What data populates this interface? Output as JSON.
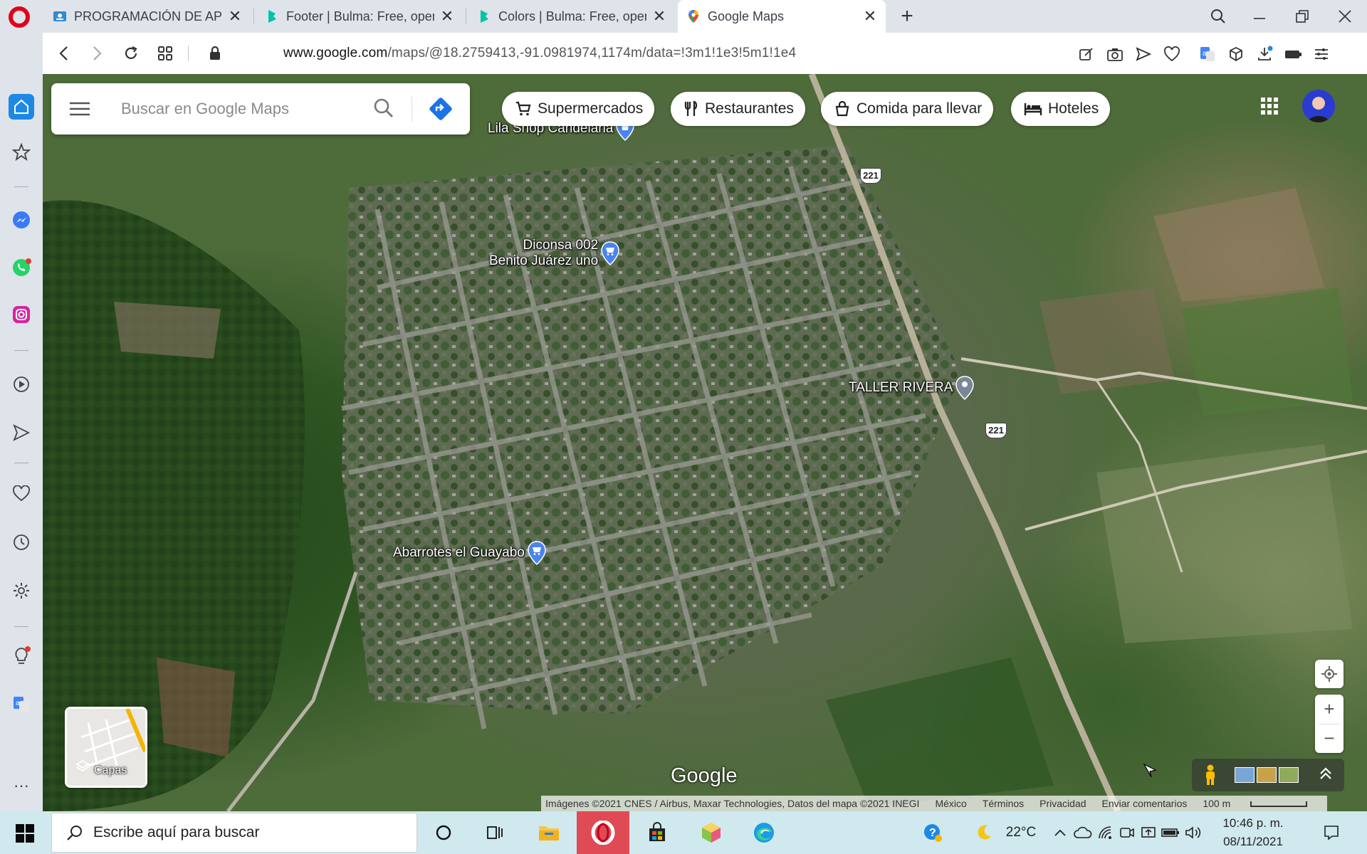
{
  "browser": {
    "tabs": [
      {
        "title": "PROGRAMACIÓN DE APLIC",
        "icon": "classroom-icon"
      },
      {
        "title": "Footer | Bulma: Free, open",
        "icon": "bulma-icon"
      },
      {
        "title": "Colors | Bulma: Free, open",
        "icon": "bulma-icon"
      },
      {
        "title": "Google Maps",
        "icon": "maps-icon",
        "active": true
      }
    ],
    "url_domain": "www.google.com",
    "url_path": "/maps/@18.2759413,-91.0981974,1174m/data=!3m1!1e3!5m1!1e4"
  },
  "maps": {
    "search_placeholder": "Buscar en Google Maps",
    "chips": [
      "Supermercados",
      "Restaurantes",
      "Comida para llevar",
      "Hoteles"
    ],
    "places": [
      {
        "name": "Lila Shop Candelaria",
        "type": "shopping",
        "color": "#4a84ef"
      },
      {
        "name_line1": "Diconsa 002",
        "name_line2": "Benito Juárez uno",
        "type": "shopping-cart",
        "color": "#4a84ef"
      },
      {
        "name": "TALLER RIVERA",
        "type": "generic",
        "color": "#7a8797"
      },
      {
        "name": "Abarrotes el Guayabo",
        "type": "shopping-cart",
        "color": "#4a84ef"
      }
    ],
    "road_shields": [
      "221",
      "221"
    ],
    "layers_label": "Capas",
    "logo": "Google",
    "attribution": "Imágenes ©2021 CNES / Airbus, Maxar Technologies, Datos del mapa ©2021 INEGI",
    "footer_links": [
      "México",
      "Términos",
      "Privacidad",
      "Enviar comentarios"
    ],
    "scale": "100 m"
  },
  "taskbar": {
    "search_text": "Escribe aquí para buscar",
    "weather": "22°C",
    "time": "10:46 p. m.",
    "date": "08/11/2021"
  },
  "colors": {
    "opera_red": "#e1001b",
    "maps_blue": "#1a73e8",
    "sidebar_active": "#1e88e5"
  }
}
